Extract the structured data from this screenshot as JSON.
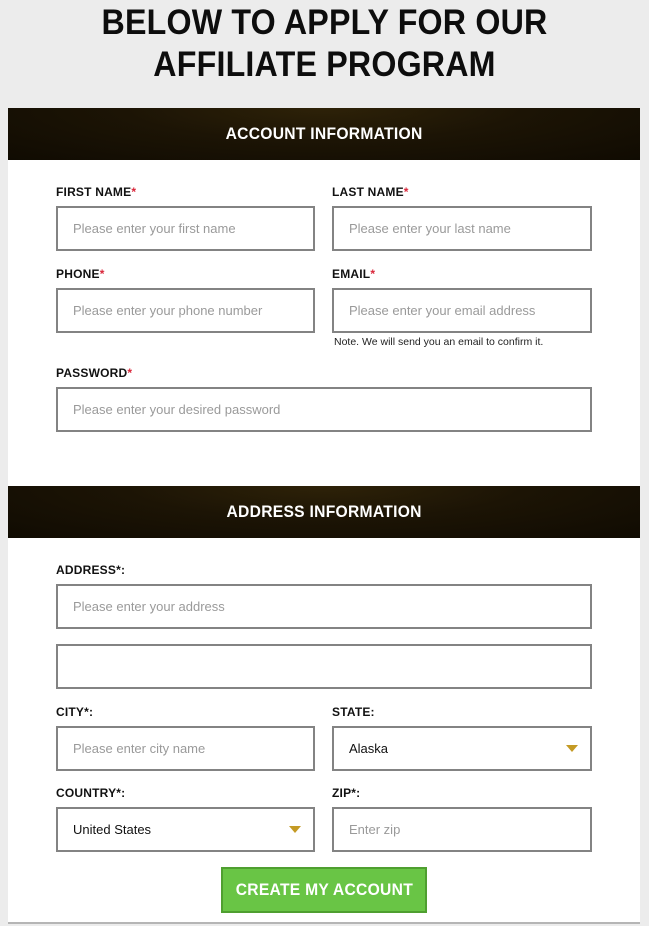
{
  "page": {
    "title": "BELOW TO APPLY FOR OUR AFFILIATE PROGRAM"
  },
  "account_section": {
    "heading": "ACCOUNT INFORMATION",
    "first_name": {
      "label": "FIRST NAME",
      "required_mark": "*",
      "placeholder": "Please enter your first name",
      "value": ""
    },
    "last_name": {
      "label": "LAST NAME",
      "required_mark": "*",
      "placeholder": "Please enter your last name",
      "value": ""
    },
    "phone": {
      "label": "PHONE",
      "required_mark": "*",
      "placeholder": "Please enter your phone number",
      "value": ""
    },
    "email": {
      "label": "EMAIL",
      "required_mark": "*",
      "placeholder": "Please enter your email address",
      "value": "",
      "note": "Note. We will send you an email to confirm it."
    },
    "password": {
      "label": "PASSWORD",
      "required_mark": "*",
      "placeholder": "Please enter your desired password",
      "value": ""
    }
  },
  "address_section": {
    "heading": "ADDRESS INFORMATION",
    "address": {
      "label": "ADDRESS*:",
      "placeholder": "Please enter your address",
      "value": ""
    },
    "address2": {
      "placeholder": "",
      "value": ""
    },
    "city": {
      "label": "CITY*:",
      "placeholder": "Please enter city name",
      "value": ""
    },
    "state": {
      "label": "STATE:",
      "selected": "Alaska",
      "icon": "caret-down-icon"
    },
    "country": {
      "label": "COUNTRY*:",
      "selected": "United States",
      "icon": "caret-down-icon"
    },
    "zip": {
      "label": "ZIP*:",
      "placeholder": "Enter zip",
      "value": ""
    }
  },
  "actions": {
    "submit_label": "CREATE MY ACCOUNT"
  },
  "colors": {
    "page_bg": "#ececec",
    "section_bar": "#1c1405",
    "required_mark": "#d9263a",
    "input_border": "#838383",
    "caret": "#c49a24",
    "submit_bg": "#69c545",
    "submit_border": "#4f9f30"
  }
}
